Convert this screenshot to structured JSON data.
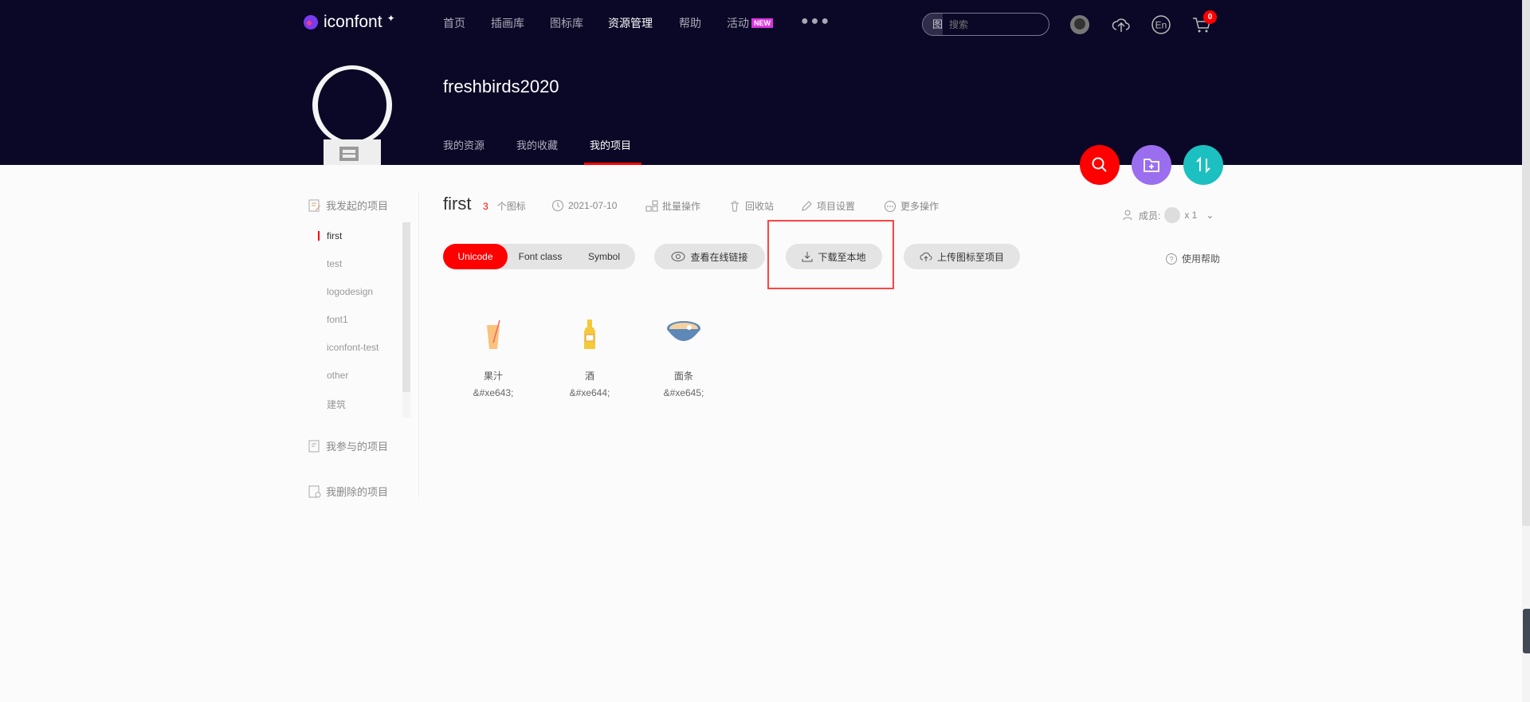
{
  "header": {
    "logo": "iconfont",
    "nav": [
      {
        "label": "首页"
      },
      {
        "label": "插画库"
      },
      {
        "label": "图标库"
      },
      {
        "label": "资源管理",
        "active": true
      },
      {
        "label": "帮助"
      },
      {
        "label": "活动",
        "badge": "NEW"
      }
    ],
    "search": {
      "type": "图标",
      "placeholder": "搜索"
    },
    "cart_count": "0"
  },
  "profile": {
    "username": "freshbirds2020",
    "tabs": [
      "我的资源",
      "我的收藏",
      "我的项目"
    ]
  },
  "sidebar": {
    "sections": [
      "我发起的项目",
      "我参与的项目",
      "我删除的项目"
    ],
    "projects": [
      "first",
      "test",
      "logodesign",
      "font1",
      "iconfont-test",
      "other",
      "建筑"
    ]
  },
  "project": {
    "name": "first",
    "count": "3",
    "count_label": "个图标",
    "date": "2021-07-10",
    "actions": [
      "批量操作",
      "回收站",
      "项目设置",
      "更多操作"
    ],
    "members_label": "成员:",
    "members_count": "x 1"
  },
  "toolbar": {
    "modes": [
      "Unicode",
      "Font class",
      "Symbol"
    ],
    "view_online": "查看在线链接",
    "download": "下载至本地",
    "upload": "上传图标至项目",
    "help": "使用帮助"
  },
  "icons": [
    {
      "name": "果汁",
      "code": "&#xe643;"
    },
    {
      "name": "酒",
      "code": "&#xe644;"
    },
    {
      "name": "面条",
      "code": "&#xe645;"
    }
  ],
  "colors": {
    "accent": "#ff0000",
    "nav_bg": "#0a0826",
    "fab_search": "#ff0000",
    "fab_folder": "#9b6ef0",
    "fab_swap": "#1cc0c0"
  }
}
